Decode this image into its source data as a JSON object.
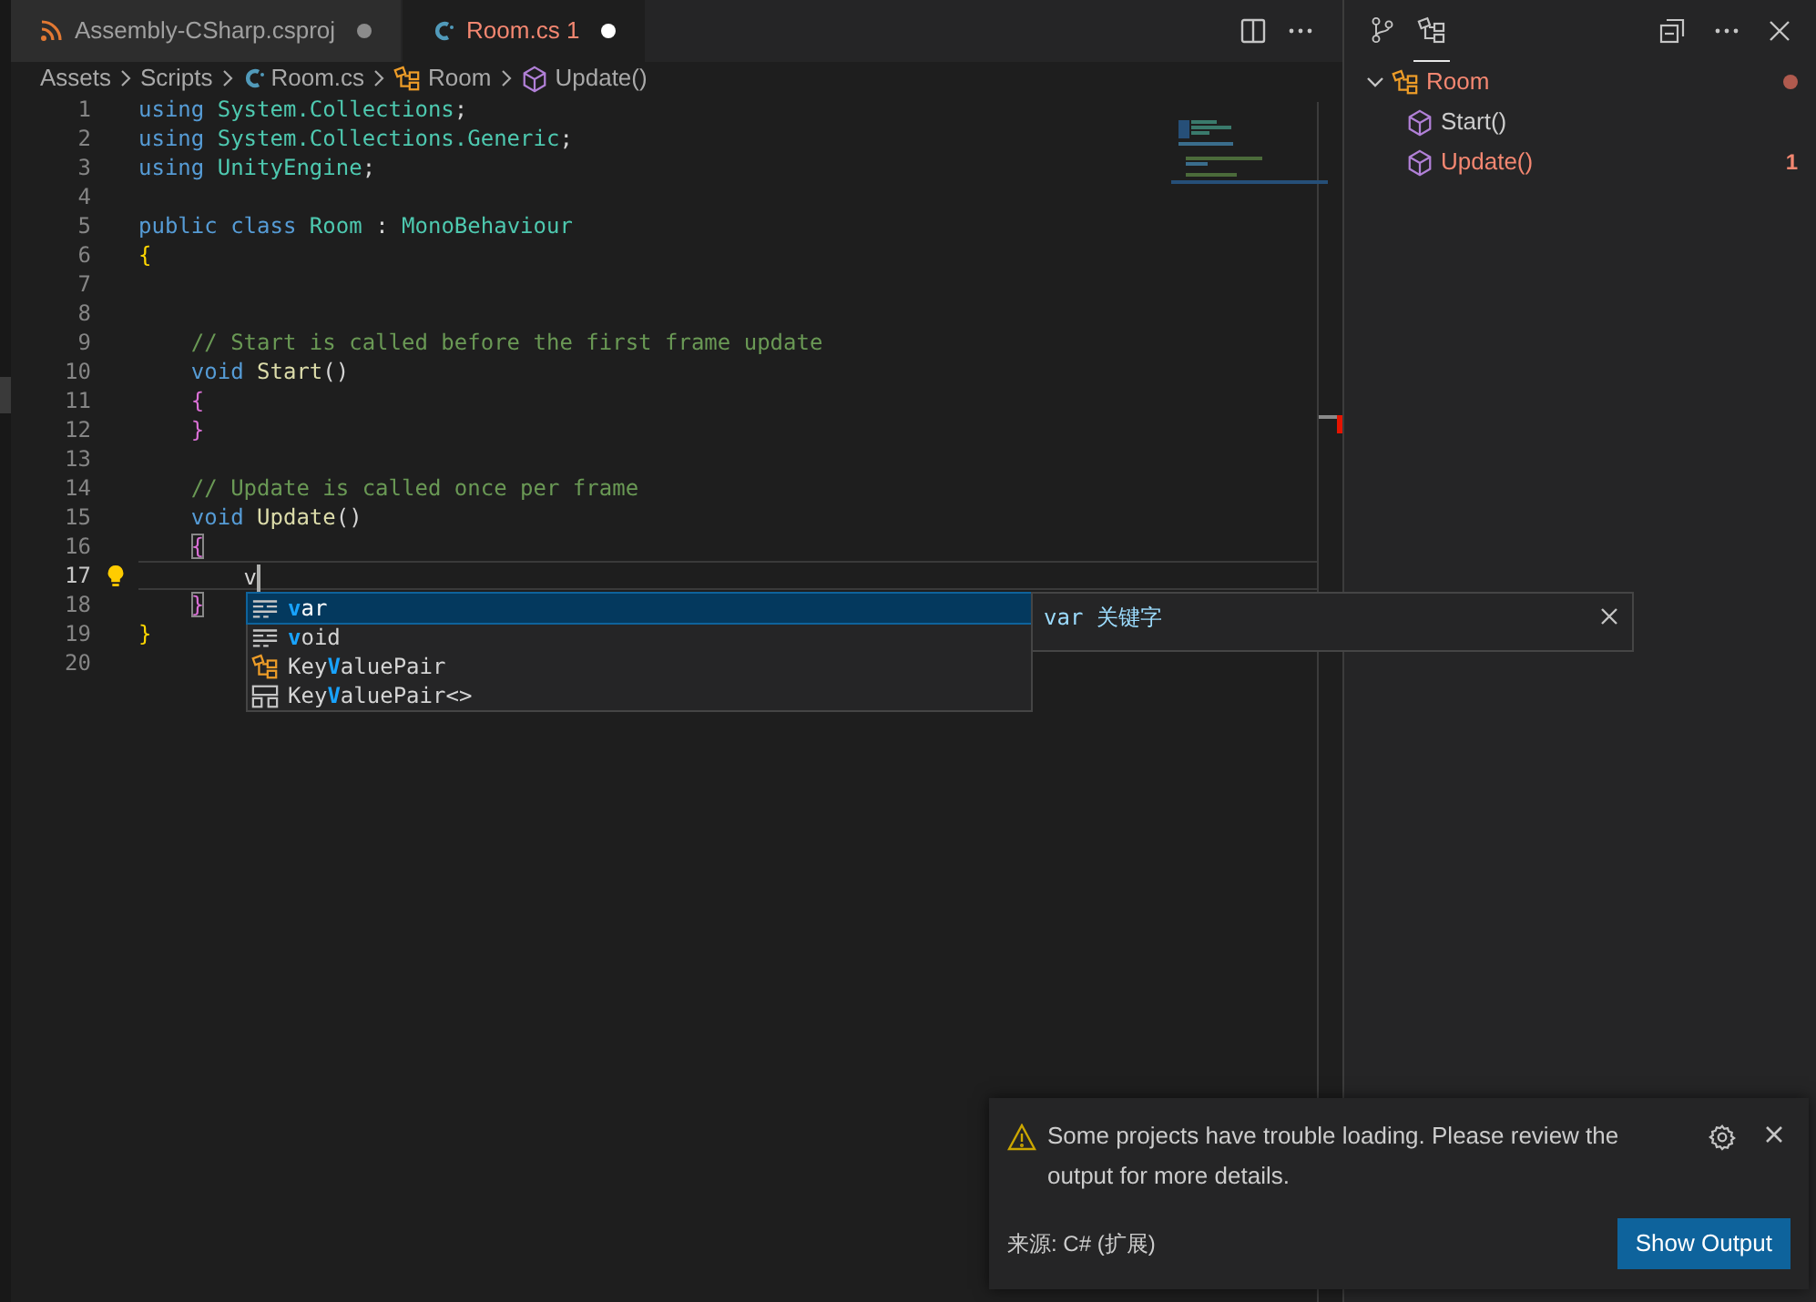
{
  "tabs": [
    {
      "label": "Assembly-CSharp.csproj",
      "kind": "project",
      "selected": false,
      "dirty": true
    },
    {
      "label": "Room.cs",
      "kind": "csharp",
      "selected": true,
      "problems": "1",
      "dirty": true
    }
  ],
  "breadcrumbs": [
    {
      "label": "Assets",
      "kind": "folder"
    },
    {
      "label": "Scripts",
      "kind": "folder"
    },
    {
      "label": "Room.cs",
      "kind": "csharp"
    },
    {
      "label": "Room",
      "kind": "class"
    },
    {
      "label": "Update()",
      "kind": "method"
    }
  ],
  "editor": {
    "lines": [
      {
        "number": "1",
        "tokens": [
          {
            "text": "using ",
            "kind": "keyword"
          },
          {
            "text": "System.Collections",
            "kind": "type"
          },
          {
            "text": ";",
            "kind": "plain"
          }
        ]
      },
      {
        "number": "2",
        "tokens": [
          {
            "text": "using ",
            "kind": "keyword"
          },
          {
            "text": "System.Collections.Generic",
            "kind": "type"
          },
          {
            "text": ";",
            "kind": "plain"
          }
        ]
      },
      {
        "number": "3",
        "tokens": [
          {
            "text": "using ",
            "kind": "keyword"
          },
          {
            "text": "UnityEngine",
            "kind": "type"
          },
          {
            "text": ";",
            "kind": "plain"
          }
        ]
      },
      {
        "number": "4"
      },
      {
        "number": "5",
        "tokens": [
          {
            "text": "public class ",
            "kind": "keyword"
          },
          {
            "text": "Room",
            "kind": "type"
          },
          {
            "text": " : ",
            "kind": "plain"
          },
          {
            "text": "MonoBehaviour",
            "kind": "type"
          }
        ]
      },
      {
        "number": "6",
        "tokens": [
          {
            "text": "{",
            "kind": "brace1"
          }
        ]
      },
      {
        "number": "7"
      },
      {
        "number": "8"
      },
      {
        "number": "9",
        "tokens": [
          {
            "text": "    // Start is called before the first frame update",
            "kind": "comment"
          }
        ]
      },
      {
        "number": "10",
        "tokens": [
          {
            "text": "    void ",
            "kind": "keyword"
          },
          {
            "text": "Start",
            "kind": "method"
          },
          {
            "text": "()",
            "kind": "plain"
          }
        ]
      },
      {
        "number": "11",
        "tokens": [
          {
            "text": "    {",
            "kind": "brace2"
          }
        ]
      },
      {
        "number": "12",
        "tokens": [
          {
            "text": "    }",
            "kind": "brace2"
          }
        ]
      },
      {
        "number": "13"
      },
      {
        "number": "14",
        "tokens": [
          {
            "text": "    // Update is called once per frame",
            "kind": "comment"
          }
        ]
      },
      {
        "number": "15",
        "tokens": [
          {
            "text": "    void ",
            "kind": "keyword"
          },
          {
            "text": "Update",
            "kind": "method"
          },
          {
            "text": "()",
            "kind": "plain"
          }
        ]
      },
      {
        "number": "16",
        "tokens": [
          {
            "text": "    {",
            "kind": "brace_matched"
          }
        ]
      },
      {
        "number": "17",
        "current": true,
        "lightbulb": true,
        "tokens": [
          {
            "text": "        v",
            "kind": "plain"
          }
        ]
      },
      {
        "number": "18",
        "tokens": [
          {
            "text": "    }",
            "kind": "brace_matched"
          }
        ]
      },
      {
        "number": "19",
        "tokens": [
          {
            "text": "}",
            "kind": "brace1"
          }
        ]
      },
      {
        "number": "20"
      }
    ]
  },
  "suggestions": [
    {
      "kind": "keyword",
      "match": "v",
      "after": "ar",
      "selected": true
    },
    {
      "kind": "keyword",
      "match": "v",
      "after": "oid",
      "selected": false
    },
    {
      "kind": "class",
      "before": "Key",
      "match": "V",
      "after": "aluePair",
      "selected": false
    },
    {
      "kind": "struct",
      "before": "Key",
      "match": "V",
      "after": "aluePair<>",
      "selected": false
    }
  ],
  "suggestion_detail": {
    "text": "var 关键字"
  },
  "side_tabs": [
    {
      "kind": "source-control",
      "selected": false
    },
    {
      "kind": "outline",
      "selected": true
    }
  ],
  "outline": [
    {
      "label": "Room",
      "kind": "class",
      "expanded": true,
      "error": true,
      "children": [
        {
          "label": "Start()",
          "kind": "method",
          "error": false
        },
        {
          "label": "Update()",
          "kind": "method",
          "error": true,
          "problems": "1"
        }
      ]
    }
  ],
  "notification": {
    "message": "Some projects have trouble loading. Please review the output for more details.",
    "source": "来源: C# (扩展)",
    "button": "Show Output"
  }
}
